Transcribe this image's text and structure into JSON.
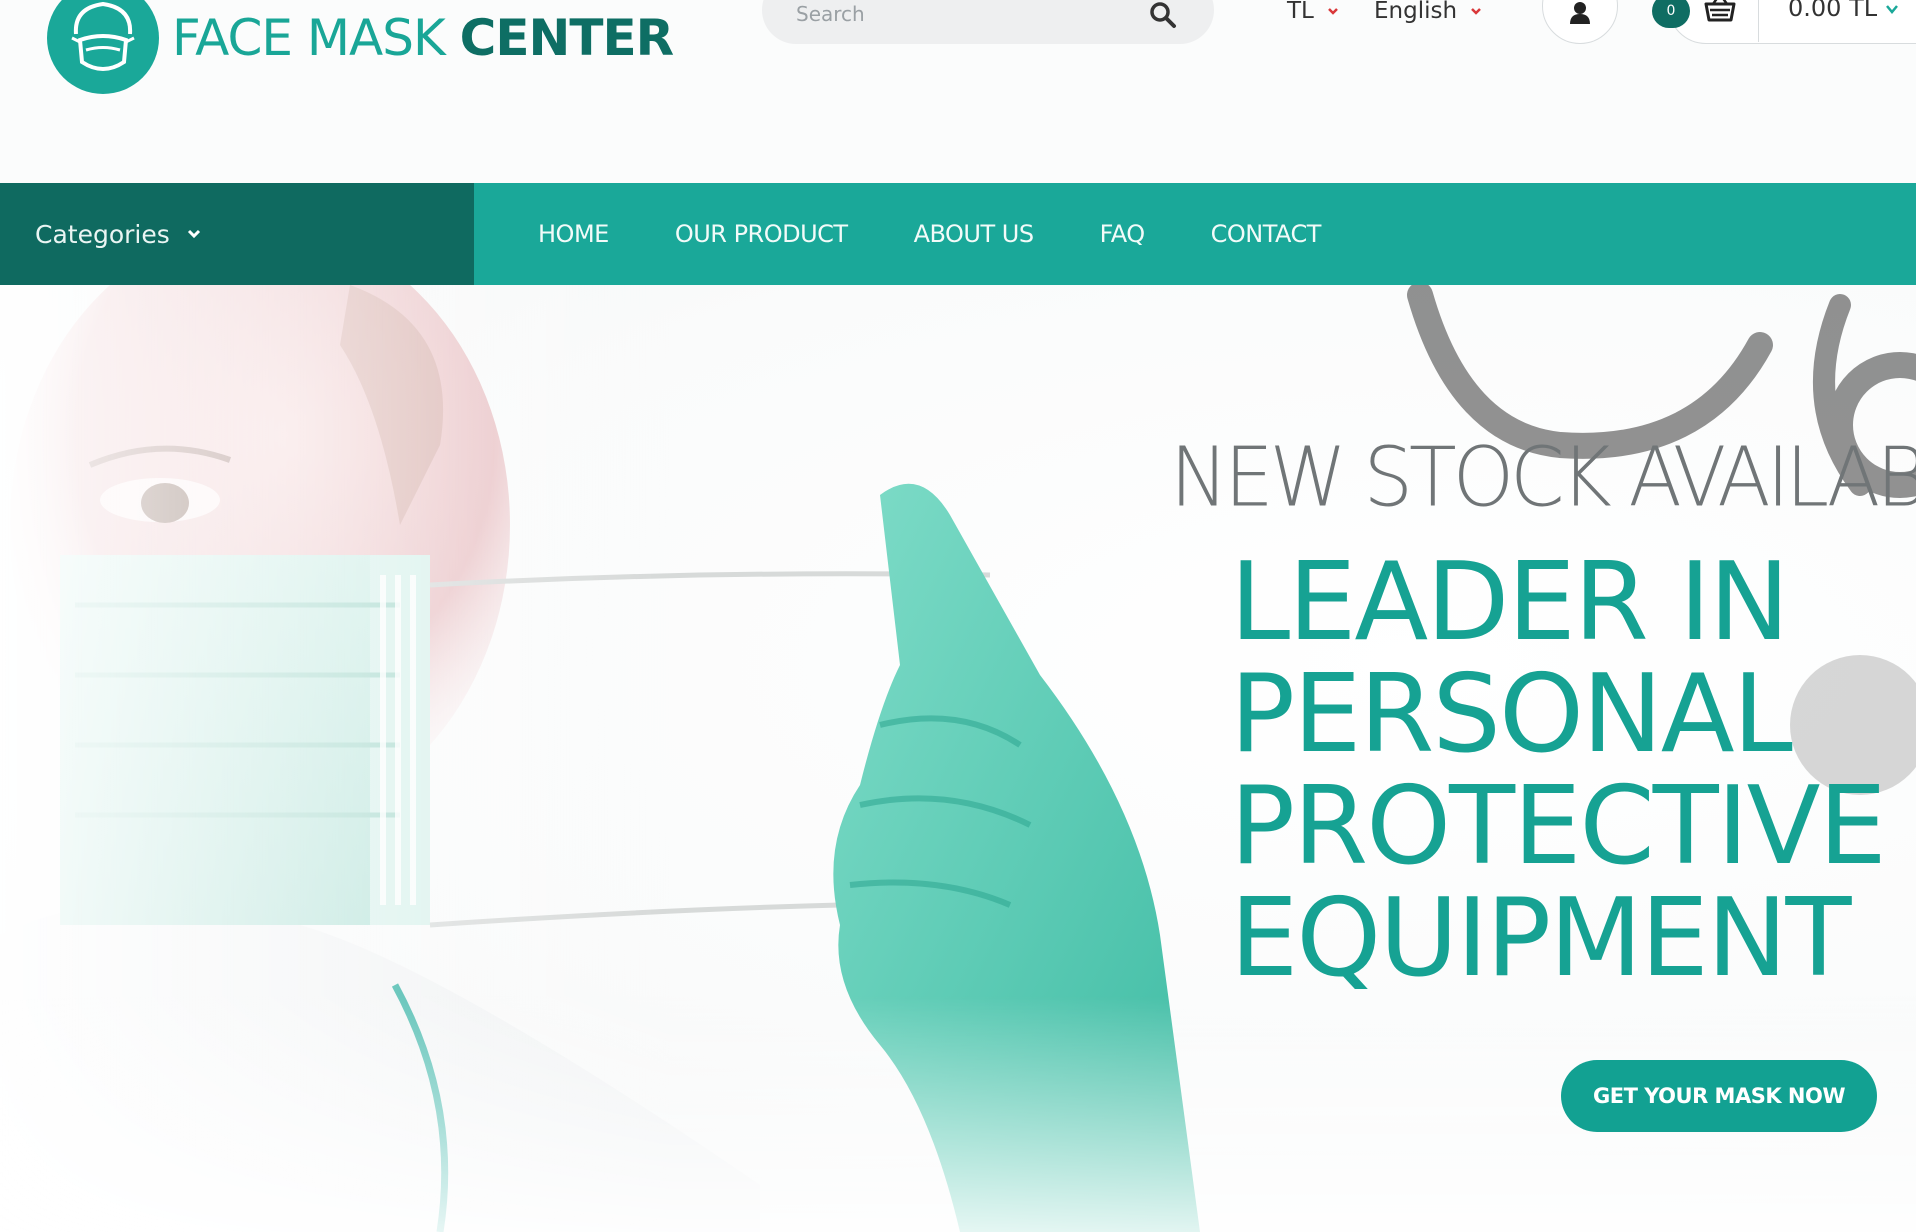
{
  "brand": {
    "name_part1": "FACE MASK ",
    "name_part2": "CENTER"
  },
  "search": {
    "placeholder": "Search"
  },
  "currency": {
    "selected": "TL"
  },
  "language": {
    "selected": "English"
  },
  "cart": {
    "count": "0",
    "total": "0.00 TL"
  },
  "nav": {
    "categories_label": "Categories",
    "items": [
      {
        "label": "HOME"
      },
      {
        "label": "OUR PRODUCT"
      },
      {
        "label": "ABOUT US"
      },
      {
        "label": "FAQ"
      },
      {
        "label": "CONTACT"
      }
    ]
  },
  "hero": {
    "subtitle": "NEW STOCK AVAILABLE",
    "title_lines": [
      "LEADER IN",
      "PERSONAL",
      "PROTECTIVE",
      "EQUIPMENT"
    ],
    "cta_label": "GET YOUR MASK NOW"
  },
  "colors": {
    "brand_teal": "#1aa899",
    "brand_dark": "#0f6a60",
    "accent_red": "#d9383a"
  },
  "icons": [
    "face-mask-logo-icon",
    "search-icon",
    "chevron-down-icon",
    "user-icon",
    "basket-icon"
  ]
}
